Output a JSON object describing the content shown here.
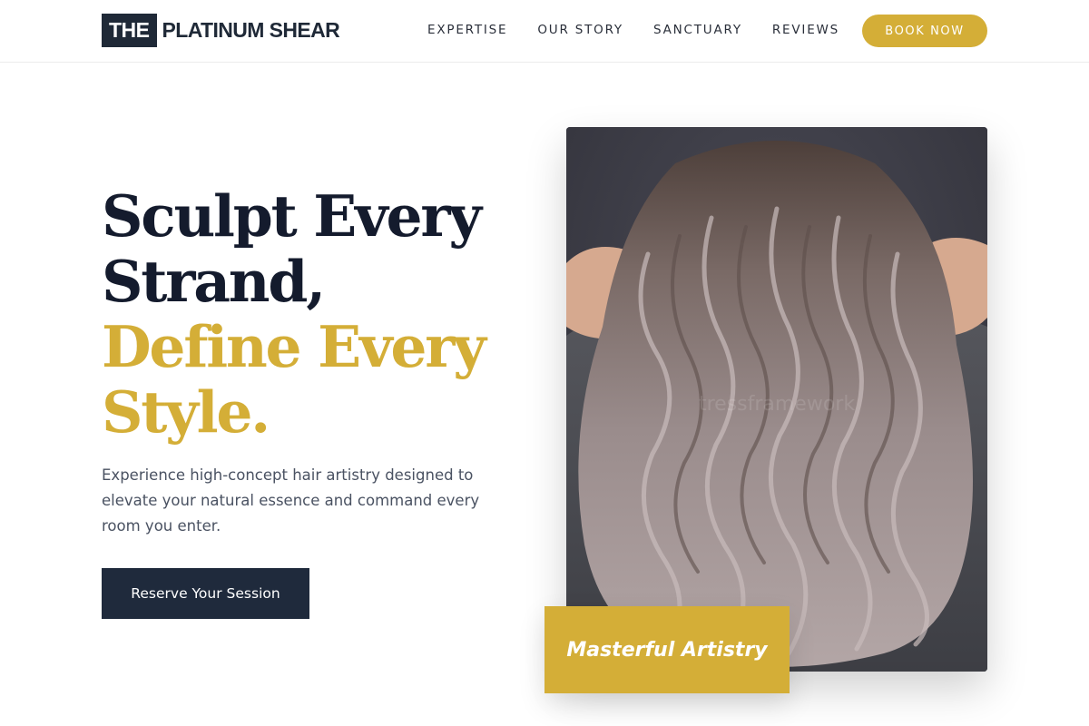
{
  "brand": {
    "box_text": "THE",
    "name": "PLATINUM SHEAR"
  },
  "nav": {
    "items": [
      {
        "label": "EXPERTISE"
      },
      {
        "label": "OUR STORY"
      },
      {
        "label": "SANCTUARY"
      },
      {
        "label": "REVIEWS"
      }
    ],
    "cta_label": "BOOK NOW"
  },
  "hero": {
    "headline_dark": [
      "Sculpt Every",
      "Strand,"
    ],
    "headline_gold": [
      "Define Every",
      "Style."
    ],
    "subtext": "Experience high-concept hair artistry designed to elevate your natural essence and command every room you enter.",
    "cta_label": "Reserve Your Session",
    "badge_text": "Masterful Artistry",
    "image_watermark": "tressframework"
  },
  "colors": {
    "accent_gold": "#d4ae37",
    "navy": "#1f2937",
    "text_dark": "#141b2d"
  }
}
